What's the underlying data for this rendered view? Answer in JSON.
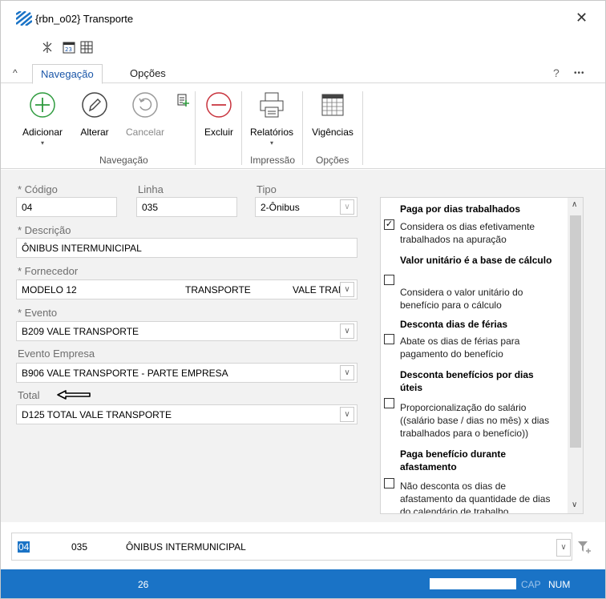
{
  "window": {
    "title": "{rbn_o02} Transporte",
    "close_glyph": "✕"
  },
  "quick_access": [
    "collapse-icon",
    "calendar-icon",
    "grid-icon"
  ],
  "tabs": {
    "collapse_glyph": "^",
    "active": "Navegação",
    "other": "Opções",
    "help": "?",
    "more": "•••"
  },
  "ribbon": {
    "adicionar": "Adicionar",
    "alterar": "Alterar",
    "cancelar": "Cancelar",
    "excluir": "Excluir",
    "relatorios": "Relatórios",
    "vigencias": "Vigências",
    "group_navegacao": "Navegação",
    "group_impressao": "Impressão",
    "group_opcoes": "Opções"
  },
  "form": {
    "codigo_label": "* Código",
    "codigo_value": "04",
    "linha_label": "Linha",
    "linha_value": "035",
    "tipo_label": "Tipo",
    "tipo_value": "2-Ônibus",
    "descricao_label": "* Descrição",
    "descricao_value": "ÔNIBUS INTERMUNICIPAL",
    "fornecedor_label": "* Fornecedor",
    "fornecedor_value_1": "MODELO 12",
    "fornecedor_value_2": "TRANSPORTE",
    "fornecedor_value_3": "VALE TRAN",
    "evento_label": "* Evento",
    "evento_value": "B209 VALE TRANSPORTE",
    "evento_empresa_label": "Evento Empresa",
    "evento_empresa_value": "B906 VALE TRANSPORTE - PARTE EMPRESA",
    "total_label": "Total",
    "total_value": "D125 TOTAL VALE TRANSPORTE"
  },
  "options": [
    {
      "title": "Paga por dias trabalhados",
      "desc": "Considera os dias efetivamente trabalhados na apuração",
      "checked": true
    },
    {
      "title": "Valor unitário é a base de cálculo",
      "desc": "Considera o valor unitário do benefício para o cálculo",
      "checked": false
    },
    {
      "title": "Desconta dias de férias",
      "desc": "Abate os dias de férias para pagamento do benefício",
      "checked": false
    },
    {
      "title": "Desconta benefícios por dias úteis",
      "desc": "Proporcionalização do salário ((salário base / dias no mês) x dias trabalhados para o benefício))",
      "checked": false
    },
    {
      "title": "Paga benefício durante afastamento",
      "desc": "Não desconta os dias de afastamento da quantidade de dias do calendário de trabalho",
      "checked": false
    }
  ],
  "bottom": {
    "codigo": "04",
    "linha": "035",
    "descricao": "ÔNIBUS INTERMUNICIPAL"
  },
  "status": {
    "count": "26",
    "cap": "CAP",
    "num": "NUM"
  },
  "colors": {
    "accent": "#1a56a8",
    "status_bg": "#1a73c6",
    "add_green": "#2e9b3e",
    "delete_red": "#c8323c"
  }
}
